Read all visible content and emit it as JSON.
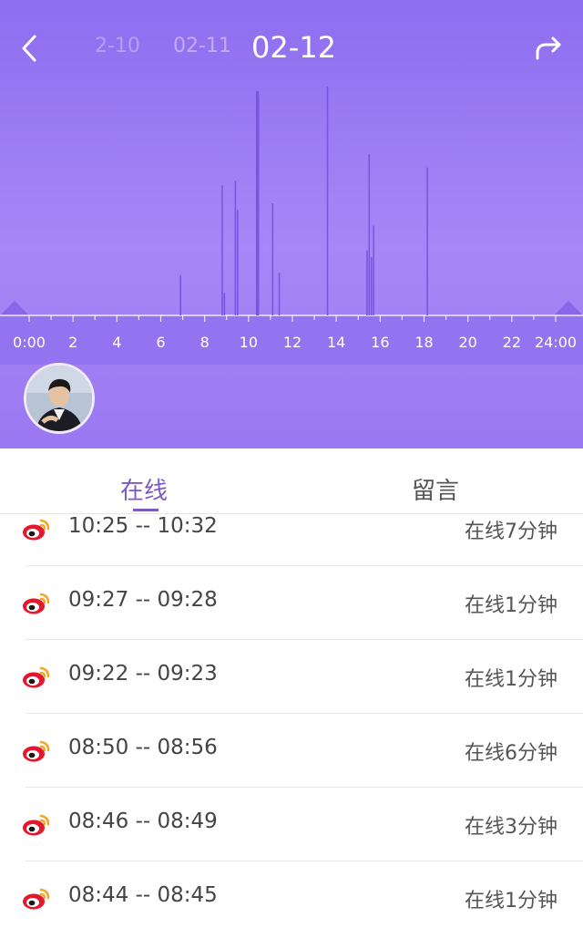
{
  "header": {
    "date_prev2": "2-10",
    "date_prev1": "02-11",
    "date_current": "02-12",
    "back_icon": "chevron-left-icon",
    "share_icon": "share-icon",
    "timeline_ticks": [
      "0:00",
      "2",
      "4",
      "6",
      "8",
      "10",
      "12",
      "14",
      "16",
      "18",
      "20",
      "22",
      "24:00"
    ],
    "activity_hours": [
      6.9,
      8.8,
      8.9,
      9.4,
      9.5,
      10.4,
      10.45,
      11.1,
      11.4,
      13.6,
      15.4,
      15.5,
      15.6,
      15.7,
      18.15
    ],
    "activity_levels": [
      0.18,
      0.58,
      0.1,
      0.6,
      0.47,
      1.0,
      0.98,
      0.5,
      0.19,
      1.02,
      0.29,
      0.72,
      0.26,
      0.4,
      0.66
    ]
  },
  "avatar": {
    "icon": "avatar"
  },
  "tabs": {
    "online": "在线",
    "message": "留言"
  },
  "sessions": [
    {
      "time": "10:25 -- 10:32",
      "duration": "在线7分钟",
      "icon": "weibo-icon"
    },
    {
      "time": "09:27 -- 09:28",
      "duration": "在线1分钟",
      "icon": "weibo-icon"
    },
    {
      "time": "09:22 -- 09:23",
      "duration": "在线1分钟",
      "icon": "weibo-icon"
    },
    {
      "time": "08:50 -- 08:56",
      "duration": "在线6分钟",
      "icon": "weibo-icon"
    },
    {
      "time": "08:46 -- 08:49",
      "duration": "在线3分钟",
      "icon": "weibo-icon"
    },
    {
      "time": "08:44 -- 08:45",
      "duration": "在线1分钟",
      "icon": "weibo-icon"
    }
  ],
  "colors": {
    "accent": "#7c5ac8",
    "header_top": "#8e6df0",
    "header_bottom": "#9a78f2",
    "weibo_red": "#e6162d",
    "weibo_orange": "#f5a623"
  }
}
